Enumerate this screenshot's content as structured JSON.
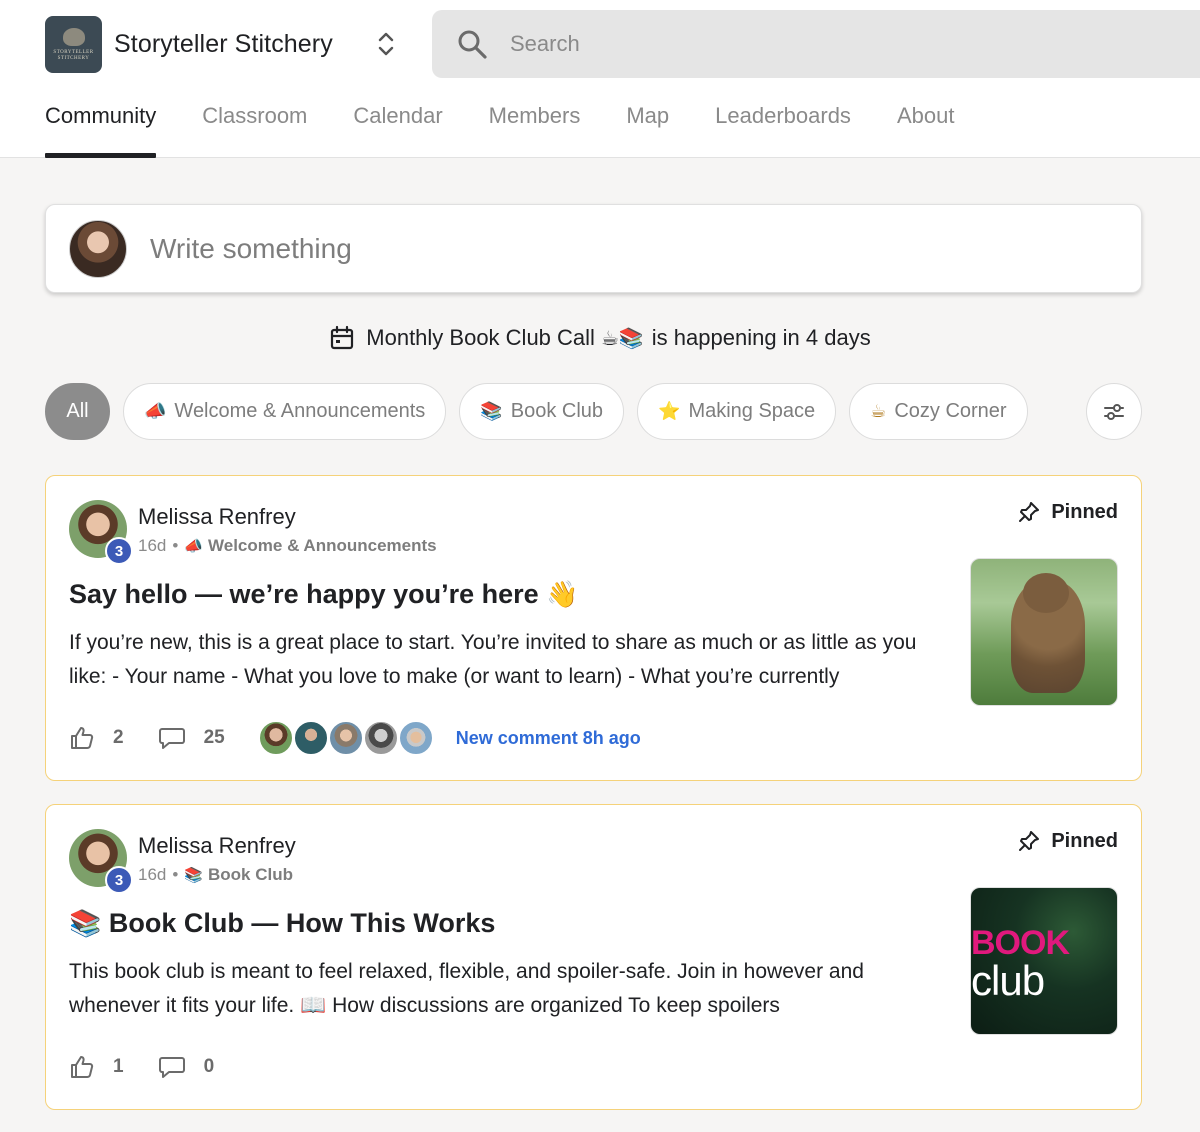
{
  "header": {
    "site_name": "Storyteller Stitchery",
    "logo_text": "STORYTELLER STITCHERY",
    "search_placeholder": "Search"
  },
  "nav": {
    "tabs": [
      {
        "label": "Community",
        "active": true
      },
      {
        "label": "Classroom",
        "active": false
      },
      {
        "label": "Calendar",
        "active": false
      },
      {
        "label": "Members",
        "active": false
      },
      {
        "label": "Map",
        "active": false
      },
      {
        "label": "Leaderboards",
        "active": false
      },
      {
        "label": "About",
        "active": false
      }
    ]
  },
  "composer": {
    "placeholder": "Write something"
  },
  "event": {
    "title": "Monthly Book Club Call",
    "emoji": "☕📚",
    "when": "is happening in 4 days"
  },
  "filters": {
    "all": "All",
    "categories": [
      {
        "emoji": "📣",
        "label": "Welcome & Announcements"
      },
      {
        "emoji": "📚",
        "label": "Book Club"
      },
      {
        "emoji": "⭐",
        "label": "Making Space"
      },
      {
        "emoji": "☕",
        "label": "Cozy Corner"
      }
    ]
  },
  "posts": [
    {
      "author": "Melissa Renfrey",
      "level": "3",
      "age": "16d",
      "category_emoji": "📣",
      "category": "Welcome & Announcements",
      "pinned_label": "Pinned",
      "title": "Say hello — we’re happy you’re here",
      "title_emoji": "👋",
      "body": "If you’re new, this is a great place to start. You’re invited to share as much or as little as you like: - Your name - What you love to make (or want to learn) - What you’re currently",
      "likes": "2",
      "comments": "25",
      "new_comment": "New comment 8h ago"
    },
    {
      "author": "Melissa Renfrey",
      "level": "3",
      "age": "16d",
      "category_emoji": "📚",
      "category": "Book Club",
      "pinned_label": "Pinned",
      "title": "Book Club — How This Works",
      "title_emoji": "📚",
      "body": "This book club is meant to feel relaxed, flexible, and spoiler-safe. Join in however and whenever it fits your life. 📖 How discussions are organized To keep spoilers",
      "likes": "1",
      "comments": "0",
      "thumb_word1": "BOOK",
      "thumb_word2": "club"
    }
  ],
  "colors": {
    "accent_blue": "#2f6bd7",
    "level_badge": "#3c5ab7",
    "pinned_border": "#f5d27a",
    "active_chip": "#8c8c8c"
  }
}
